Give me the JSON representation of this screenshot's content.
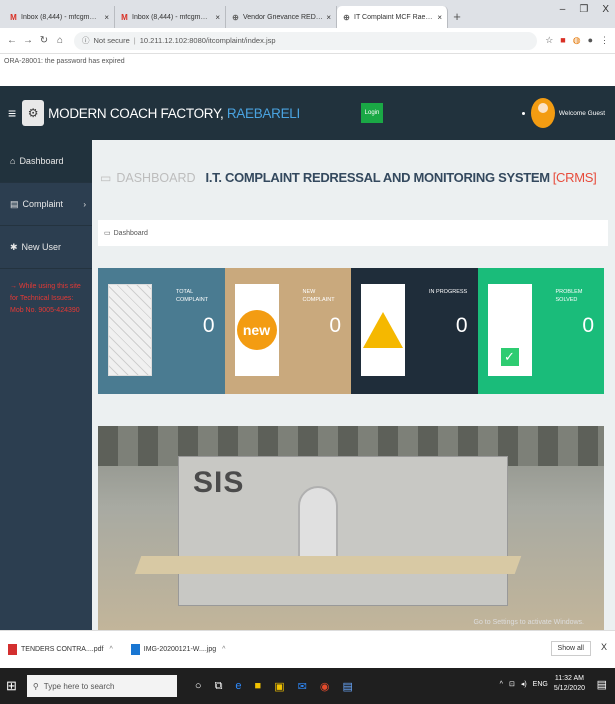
{
  "browser": {
    "tabs": [
      {
        "icon": "gmail-icon",
        "title": "Inbox (8,444) - mfcgm@gmail.c",
        "active": false
      },
      {
        "icon": "gmail-icon",
        "title": "Inbox (8,444) - mfcgm@gmail.c",
        "active": false
      },
      {
        "icon": "globe-icon",
        "title": "Vendor Grievance REDRESSAL s",
        "active": false
      },
      {
        "icon": "globe-icon",
        "title": "IT Complaint MCF Raebareli",
        "active": true
      }
    ],
    "new_tab": "+",
    "window_controls": [
      "–",
      "❐",
      "X"
    ],
    "address": {
      "secure_label": "Not secure",
      "url": "10.211.12.102:8080/itcomplaint/index.jsp"
    },
    "info_text": "ORA-28001: the password has expired"
  },
  "app": {
    "brand_main": "MODERN COACH FACTORY,",
    "brand_accent": " RAEBARELI",
    "login_label": "Login",
    "user_label": "Welcome Guest"
  },
  "sidebar": {
    "items": [
      {
        "icon": "dashboard-icon",
        "label": "Dashboard"
      },
      {
        "icon": "file-icon",
        "label": "Complaint",
        "chevron": "›"
      },
      {
        "icon": "user-add-icon",
        "label": "New User"
      }
    ],
    "note": "→ While using this site for Technical Issues: Mob No. 9005-424390"
  },
  "main": {
    "header_dash": "DASHBOARD",
    "header_title": "I.T. COMPLAINT REDRESSAL AND MONITORING SYSTEM",
    "header_accent": "[CRMS]",
    "breadcrumb": "Dashboard",
    "cards": [
      {
        "label": "TOTAL COMPLAINT",
        "count": "0",
        "color": "#4a7b91",
        "icon": "keyboard-icon"
      },
      {
        "label": "NEW COMPLAINT",
        "count": "0",
        "color": "#c9a97d",
        "icon": "new-badge-icon",
        "badge_text": "new"
      },
      {
        "label": "IN PROGRESS",
        "count": "0",
        "color": "#1f2d3a",
        "icon": "work-in-progress-icon"
      },
      {
        "label": "PROBLEM SOLVED",
        "count": "0",
        "color": "#1abc7a",
        "icon": "checkmark-icon"
      }
    ],
    "photo_text": "SIS",
    "watermark": "Go to Settings to activate Windows."
  },
  "downloads": {
    "items": [
      {
        "name": "TENDERS CONTRA....pdf",
        "icon": "pdf-icon"
      },
      {
        "name": "IMG-20200121-W....jpg",
        "icon": "image-icon"
      }
    ],
    "show_all": "Show all",
    "close": "X"
  },
  "taskbar": {
    "search_placeholder": "Type here to search",
    "time": "11:32 AM",
    "date": "5/12/2020",
    "lang": "ENG"
  }
}
